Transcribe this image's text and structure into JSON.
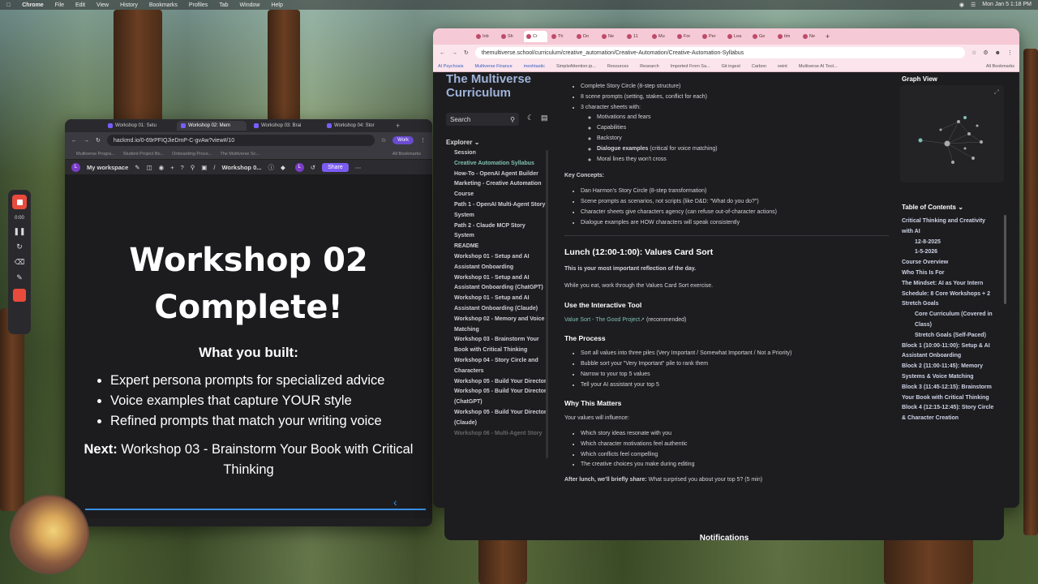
{
  "menubar": {
    "app": "Chrome",
    "items": [
      "File",
      "Edit",
      "View",
      "History",
      "Bookmarks",
      "Profiles",
      "Tab",
      "Window",
      "Help"
    ],
    "datetime": "Mon Jan 5  1:18 PM"
  },
  "recorder": {
    "time": "0:00"
  },
  "left_window": {
    "tabs": [
      "Workshop 01: Setu",
      "Workshop 02: Mem",
      "Workshop 03: Brai",
      "Workshop 04: Stor"
    ],
    "url": "hackmd.io/0-69rPFIQJieDmP-C-gvAw?view#/10",
    "work_label": "Work",
    "bookmarks": [
      "Multiverse Progra...",
      "Student Project Bo...",
      "Onboarding Proce...",
      "The Multiverse Sc...",
      "All Bookmarks"
    ],
    "workspace": "My workspace",
    "doc_title": "Workshop 0...",
    "share": "Share",
    "slide": {
      "title_line1": "Workshop 02",
      "title_line2": "Complete!",
      "subtitle": "What you built:",
      "bullets": [
        "Expert persona prompts for specialized advice",
        "Voice examples that capture YOUR style",
        "Refined prompts that match your writing voice"
      ],
      "next_label": "Next:",
      "next_text": "Workshop 03 - Brainstorm Your Book with Critical Thinking"
    }
  },
  "right_window": {
    "tabs": [
      "Inb",
      "Sh",
      "Cr",
      "Th",
      "Do",
      "Ne",
      "11",
      "Mu",
      "For",
      "Per",
      "Lea",
      "Ge",
      "tim",
      "Ne"
    ],
    "url": "themultiverse.school/curriculum/creative_automation/Creative-Automation/Creative-Automation-Syllabus",
    "bookmarks": [
      "AI Psychosis",
      "Multiverse Finance",
      "meshtastic",
      "SimpleAttention.ip...",
      "Resources",
      "Research",
      "Imported From Sa...",
      "Git ingest",
      "Carbon",
      "oeint",
      "Multiverse AI Tool...",
      "All Bookmarks"
    ],
    "brand": "The Multiverse Curriculum",
    "search": "Search",
    "explorer": "Explorer",
    "nav": [
      "Session",
      "Creative Automation Syllabus",
      "How-To - OpenAI Agent Builder",
      "Marketing - Creative Automation Course",
      "Path 1 - OpenAI Multi-Agent Story System",
      "Path 2 - Claude MCP Story System",
      "README",
      "Workshop 01 - Setup and AI Assistant Onboarding",
      "Workshop 01 - Setup and AI Assistant Onboarding (ChatGPT)",
      "Workshop 01 - Setup and AI Assistant Onboarding (Claude)",
      "Workshop 02 - Memory and Voice Matching",
      "Workshop 03 - Brainstorm Your Book with Critical Thinking",
      "Workshop 04 - Story Circle and Characters",
      "Workshop 05 - Build Your Director",
      "Workshop 05 - Build Your Director (ChatGPT)",
      "Workshop 05 - Build Your Director (Claude)",
      "Workshop 06 - Multi-Agent Story"
    ],
    "main": {
      "top_bullets": [
        "Complete Story Circle (8-step structure)",
        "8 scene prompts (setting, stakes, conflict for each)",
        "3 character sheets with:"
      ],
      "sheet_items": [
        "Motivations and fears",
        "Capabilities",
        "Backstory",
        "Dialogue examples",
        "Moral lines they won't cross"
      ],
      "dialogue_note": " (critical for voice matching)",
      "key_concepts_label": "Key Concepts:",
      "key_concepts": [
        "Dan Harmon's Story Circle (8-step transformation)",
        "Scene prompts as scenarios, not scripts (like D&D: \"What do you do?\")",
        "Character sheets give characters agency (can refuse out-of-character actions)",
        "Dialogue examples are HOW characters will speak consistently"
      ],
      "lunch_heading": "Lunch (12:00-1:00): Values Card Sort",
      "lunch_bold": "This is your most important reflection of the day.",
      "lunch_text": "While you eat, work through the Values Card Sort exercise.",
      "tool_heading": "Use the Interactive Tool",
      "tool_link": "Value Sort - The Good Project",
      "tool_rec": " (recommended)",
      "process_heading": "The Process",
      "process_steps": [
        "Sort all values into three piles (Very Important / Somewhat Important / Not a Priority)",
        "Bubble sort your \"Very Important\" pile to rank them",
        "Narrow to your top 5 values",
        "Tell your AI assistant your top 5"
      ],
      "why_heading": "Why This Matters",
      "why_text": "Your values will influence:",
      "why_items": [
        "Which story ideas resonate with you",
        "Which character motivations feel authentic",
        "Which conflicts feel compelling",
        "The creative choices you make during editing"
      ],
      "after_bold": "After lunch, we'll briefly share:",
      "after_text": " What surprised you about your top 5? (5 min)"
    },
    "graph_view": "Graph View",
    "toc_label": "Table of Contents",
    "toc": [
      {
        "text": "Critical Thinking and Creativity with AI",
        "indent": 0
      },
      {
        "text": "12-8-2025",
        "indent": 1
      },
      {
        "text": "1-5-2026",
        "indent": 1
      },
      {
        "text": "Course Overview",
        "indent": 0
      },
      {
        "text": "Who This Is For",
        "indent": 0
      },
      {
        "text": "The Mindset: AI as Your Intern",
        "indent": 0
      },
      {
        "text": "Schedule: 8 Core Workshops + 2 Stretch Goals",
        "indent": 0
      },
      {
        "text": "Core Curriculum (Covered in Class)",
        "indent": 1
      },
      {
        "text": "Stretch Goals (Self-Paced)",
        "indent": 1
      },
      {
        "text": "Block 1 (10:00-11:00): Setup & AI Assistant Onboarding",
        "indent": 0
      },
      {
        "text": "Block 2 (11:00-11:45): Memory Systems & Voice Matching",
        "indent": 0
      },
      {
        "text": "Block 3 (11:45-12:15): Brainstorm Your Book with Critical Thinking",
        "indent": 0
      },
      {
        "text": "Block 4 (12:15-12:45): Story Circle & Character Creation",
        "indent": 0
      }
    ]
  },
  "notifications": "Notifications"
}
